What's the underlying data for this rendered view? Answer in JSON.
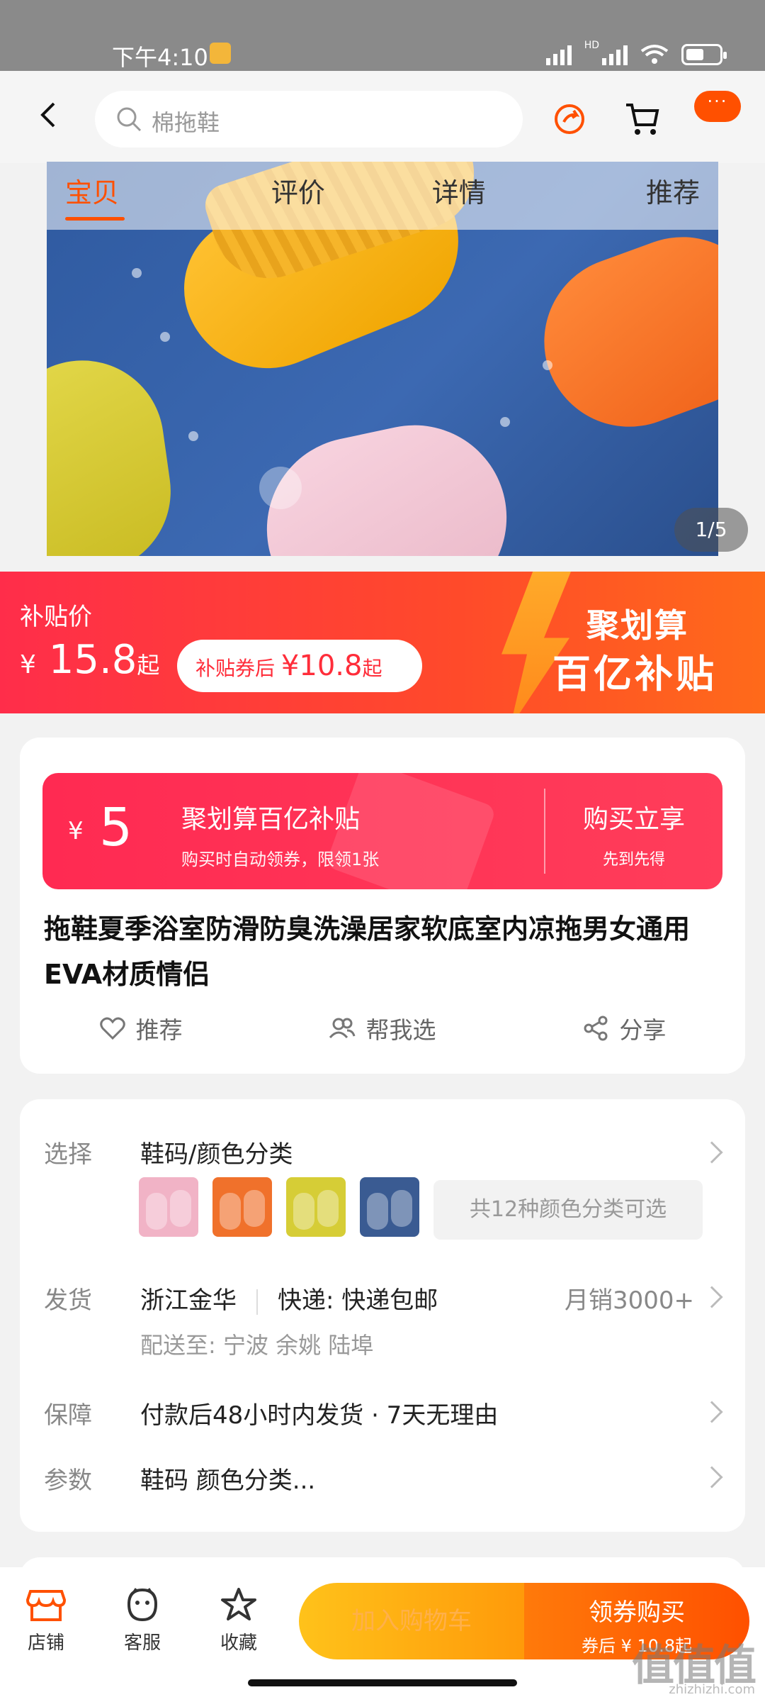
{
  "status_bar": {
    "time": "下午4:10",
    "hd": "HD"
  },
  "top_bar": {
    "search_text": "棉拖鞋",
    "more_label": "···"
  },
  "gallery": {
    "tabs": [
      "宝贝",
      "评价",
      "详情",
      "推荐"
    ],
    "active_tab": "宝贝",
    "pager": "1/5"
  },
  "price_banner": {
    "label": "补贴价",
    "currency": "¥",
    "price": "15.8",
    "price_suffix": "起",
    "coupon_prefix": "补贴券后",
    "coupon_price": "¥10.8",
    "coupon_suffix": "起",
    "promo_line1": "聚划算",
    "promo_line2": "百亿补贴"
  },
  "coupon": {
    "currency": "¥",
    "amount": "5",
    "title": "聚划算百亿补贴",
    "subtitle": "购买时自动领券，限领1张",
    "button": "购买立享",
    "button_sub": "先到先得"
  },
  "product": {
    "title": "拖鞋夏季浴室防滑防臭洗澡居家软底室内凉拖男女通用EVA材质情侣"
  },
  "actions": [
    {
      "label": "推荐",
      "icon": "heart-icon"
    },
    {
      "label": "帮我选",
      "icon": "people-icon"
    },
    {
      "label": "分享",
      "icon": "share-icon"
    }
  ],
  "details": {
    "select_label": "选择",
    "select_value": "鞋码/颜色分类",
    "color_thumbs": [
      "#f1b3c6",
      "#f0712b",
      "#d6cd36",
      "#3a5b92"
    ],
    "color_count": "共12种颜色分类可选",
    "ship_label": "发货",
    "ship_from": "浙江金华",
    "ship_method": "快递: 快递包邮",
    "monthly_sales": "月销3000+",
    "deliver_to": "配送至: 宁波 余姚 陆埠",
    "guarantee_label": "保障",
    "guarantee_value": "付款后48小时内发货 · 7天无理由",
    "params_label": "参数",
    "params_value": "鞋码 颜色分类..."
  },
  "bottom_bar": {
    "shop": "店铺",
    "service": "客服",
    "favorite": "收藏",
    "add_cart": "加入购物车",
    "buy": "领券购买",
    "buy_sub": "券后 ¥ 10.8起"
  },
  "watermark": {
    "main": "值值值",
    "sub": "zhizhizhi.com"
  },
  "colors": {
    "accent": "#ff5000",
    "red": "#ff2d4a",
    "yellow": "#ffc21a"
  }
}
